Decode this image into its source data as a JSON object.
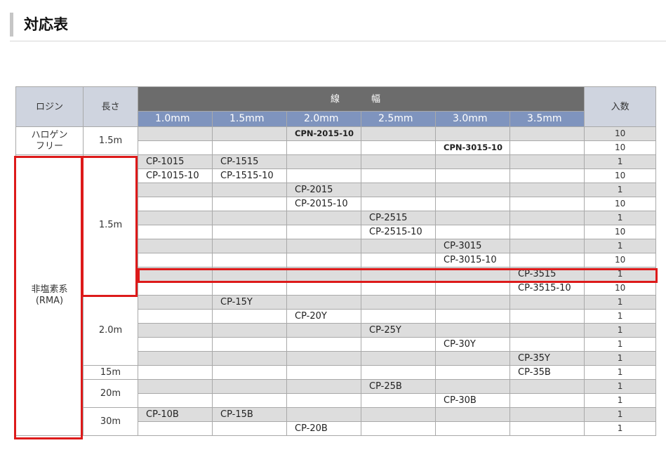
{
  "section_title": "対応表",
  "table": {
    "headers": {
      "rosin": "ロジン",
      "length": "長さ",
      "width": "線　幅",
      "quantity": "入数"
    },
    "widths": [
      "1.0mm",
      "1.5mm",
      "2.0mm",
      "2.5mm",
      "3.0mm",
      "3.5mm"
    ],
    "groups": {
      "halogen_free": "ハロゲン\nフリー",
      "non_chloride": "非塩素系\n(RMA)"
    },
    "lengths": {
      "l15a": "1.5m",
      "l15b": "1.5m",
      "l20": "2.0m",
      "l15m": "15m",
      "l20m": "20m",
      "l30m": "30m"
    },
    "rows": [
      {
        "cells": [
          "",
          "",
          "CPN-2015-10",
          "",
          "",
          ""
        ],
        "qty": "10"
      },
      {
        "cells": [
          "",
          "",
          "",
          "",
          "CPN-3015-10",
          ""
        ],
        "qty": "10"
      },
      {
        "cells": [
          "CP-1015",
          "CP-1515",
          "",
          "",
          "",
          ""
        ],
        "qty": "1"
      },
      {
        "cells": [
          "CP-1015-10",
          "CP-1515-10",
          "",
          "",
          "",
          ""
        ],
        "qty": "10"
      },
      {
        "cells": [
          "",
          "",
          "CP-2015",
          "",
          "",
          ""
        ],
        "qty": "1"
      },
      {
        "cells": [
          "",
          "",
          "CP-2015-10",
          "",
          "",
          ""
        ],
        "qty": "10"
      },
      {
        "cells": [
          "",
          "",
          "",
          "CP-2515",
          "",
          ""
        ],
        "qty": "1"
      },
      {
        "cells": [
          "",
          "",
          "",
          "CP-2515-10",
          "",
          ""
        ],
        "qty": "10"
      },
      {
        "cells": [
          "",
          "",
          "",
          "",
          "CP-3015",
          ""
        ],
        "qty": "1"
      },
      {
        "cells": [
          "",
          "",
          "",
          "",
          "CP-3015-10",
          ""
        ],
        "qty": "10"
      },
      {
        "cells": [
          "",
          "",
          "",
          "",
          "",
          "CP-3515"
        ],
        "qty": "1"
      },
      {
        "cells": [
          "",
          "",
          "",
          "",
          "",
          "CP-3515-10"
        ],
        "qty": "10"
      },
      {
        "cells": [
          "",
          "CP-15Y",
          "",
          "",
          "",
          ""
        ],
        "qty": "1"
      },
      {
        "cells": [
          "",
          "",
          "CP-20Y",
          "",
          "",
          ""
        ],
        "qty": "1"
      },
      {
        "cells": [
          "",
          "",
          "",
          "CP-25Y",
          "",
          ""
        ],
        "qty": "1"
      },
      {
        "cells": [
          "",
          "",
          "",
          "",
          "CP-30Y",
          ""
        ],
        "qty": "1"
      },
      {
        "cells": [
          "",
          "",
          "",
          "",
          "",
          "CP-35Y"
        ],
        "qty": "1"
      },
      {
        "cells": [
          "",
          "",
          "",
          "",
          "",
          "CP-35B"
        ],
        "qty": "1"
      },
      {
        "cells": [
          "",
          "",
          "",
          "CP-25B",
          "",
          ""
        ],
        "qty": "1"
      },
      {
        "cells": [
          "",
          "",
          "",
          "",
          "CP-30B",
          ""
        ],
        "qty": "1"
      },
      {
        "cells": [
          "CP-10B",
          "CP-15B",
          "",
          "",
          "",
          ""
        ],
        "qty": "1"
      },
      {
        "cells": [
          "",
          "",
          "CP-20B",
          "",
          "",
          ""
        ],
        "qty": "1"
      }
    ]
  },
  "highlight_color": "#dd1a1a"
}
